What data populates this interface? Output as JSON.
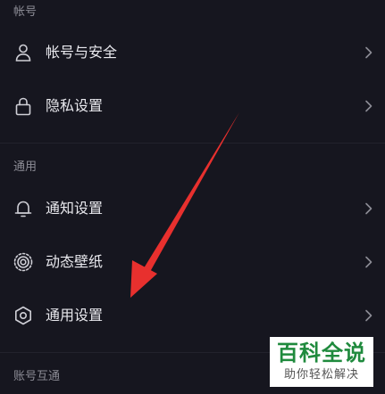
{
  "sections": {
    "account_title": "帐号",
    "general_title": "通用",
    "interop_title": "账号互通"
  },
  "items": {
    "account_security": {
      "label": "帐号与安全",
      "icon": "user-icon"
    },
    "privacy": {
      "label": "隐私设置",
      "icon": "lock-icon"
    },
    "notifications": {
      "label": "通知设置",
      "icon": "bell-icon"
    },
    "wallpaper": {
      "label": "动态壁纸",
      "icon": "wallpaper-icon"
    },
    "general": {
      "label": "通用设置",
      "icon": "gear-icon"
    }
  },
  "watermark": {
    "title": "百科全说",
    "subtitle": "助你轻松解决"
  },
  "colors": {
    "background": "#16161f",
    "text": "#e9e9ee",
    "muted": "#8c8c95",
    "arrow": "#e8302e",
    "watermark_green": "#1f8a3d"
  }
}
